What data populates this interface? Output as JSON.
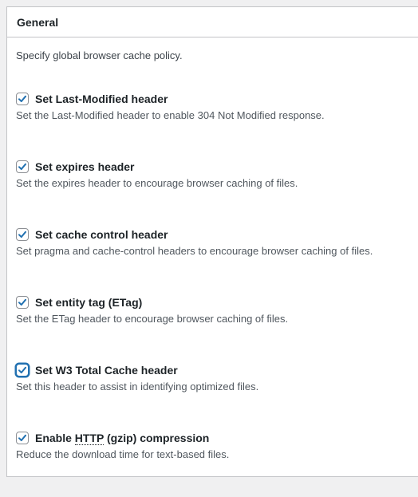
{
  "section": {
    "title": "General"
  },
  "intro": "Specify global browser cache policy.",
  "options": [
    {
      "label": "Set Last-Modified header",
      "checked": true,
      "desc": "Set the Last-Modified header to enable 304 Not Modified response."
    },
    {
      "label": "Set expires header",
      "checked": true,
      "desc": "Set the expires header to encourage browser caching of files."
    },
    {
      "label": "Set cache control header",
      "checked": true,
      "desc": "Set pragma and cache-control headers to encourage browser caching of files."
    },
    {
      "label": "Set entity tag (ETag)",
      "checked": true,
      "desc": "Set the ETag header to encourage browser caching of files."
    },
    {
      "label": "Set W3 Total Cache header",
      "checked": true,
      "desc": "Set this header to assist in identifying optimized files."
    },
    {
      "label_before": "Enable ",
      "label_abbr": "HTTP",
      "label_after": " (gzip) compression",
      "checked": true,
      "desc": "Reduce the download time for text-based files."
    }
  ],
  "colors": {
    "check": "#2271b1",
    "focus": "#2271b1"
  }
}
